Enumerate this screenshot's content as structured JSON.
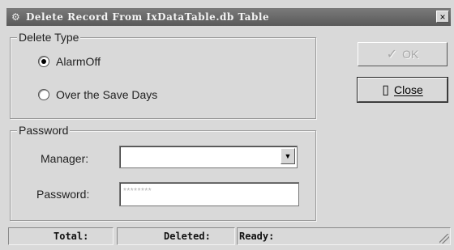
{
  "window": {
    "title": "Delete Record From IxDataTable.db Table",
    "title_icon": "app-icon",
    "close_glyph": "×"
  },
  "delete_type": {
    "label": "Delete Type",
    "options": [
      {
        "label": "AlarmOff",
        "checked": true
      },
      {
        "label": "Over the Save Days",
        "checked": false
      }
    ]
  },
  "password_group": {
    "label": "Password",
    "manager_label": "Manager:",
    "manager_value": "",
    "password_label": "Password:",
    "password_value": "********"
  },
  "buttons": {
    "ok_label": "OK",
    "close_label": "Close"
  },
  "status": {
    "total": "Total:",
    "deleted": "Deleted:",
    "state": "Ready:"
  }
}
